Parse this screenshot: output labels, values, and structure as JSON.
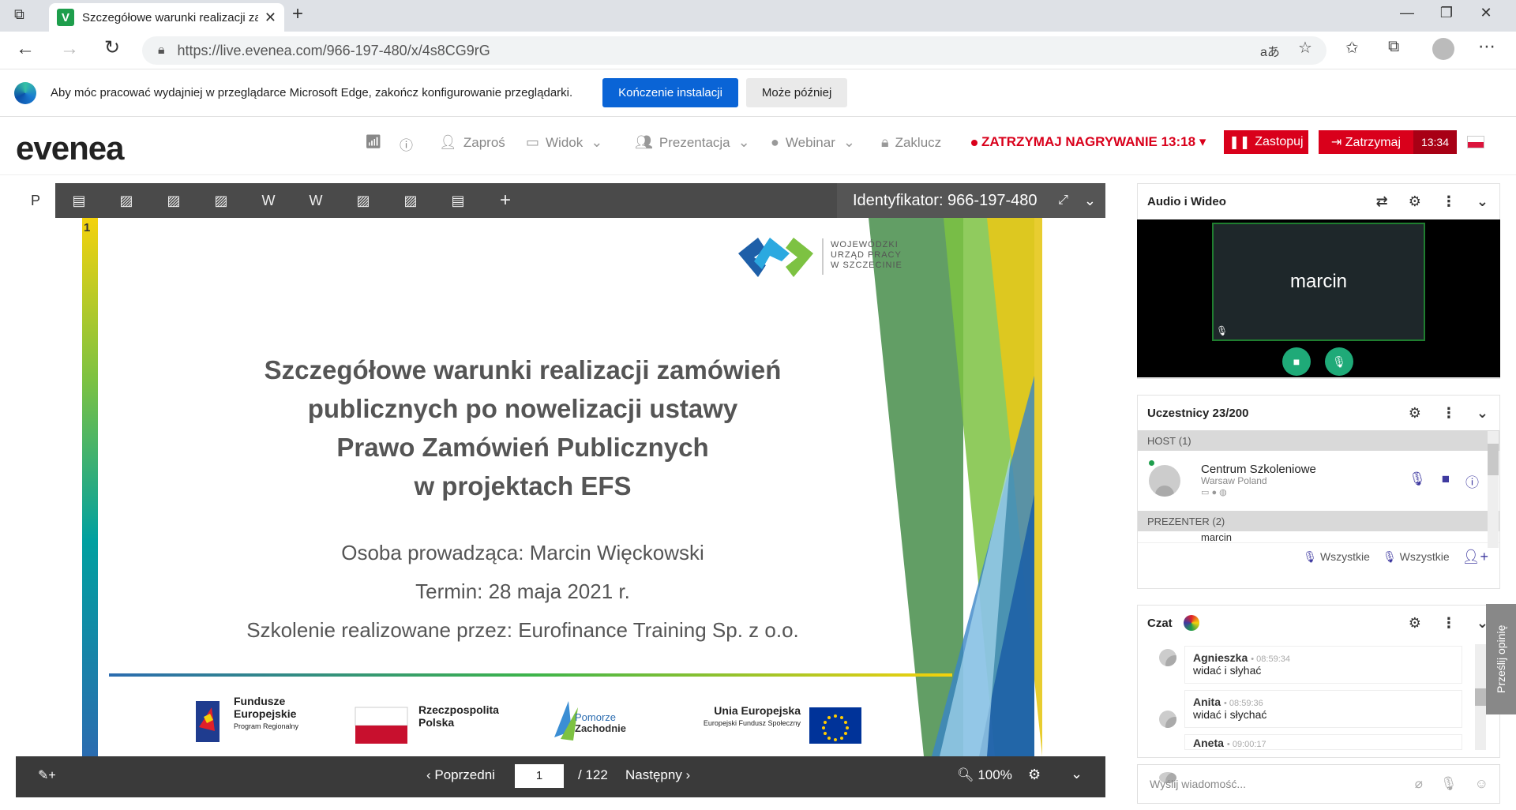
{
  "browser": {
    "tab_title": "Szczegółowe warunki realizacji za",
    "url": "https://live.evenea.com/966-197-480/x/4s8CG9rG"
  },
  "infobar": {
    "message": "Aby móc pracować wydajniej w przeglądarce Microsoft Edge, zakończ konfigurowanie przeglądarki.",
    "finish_label": "Kończenie instalacji",
    "later_label": "Może później"
  },
  "app": {
    "logo": "evenea",
    "menu": {
      "invite": "Zaproś",
      "view": "Widok",
      "presentation": "Prezentacja",
      "webinar": "Webinar",
      "lock": "Zaklucz"
    },
    "recording": "ZATRZYMAJ NAGRYWANIE 13:18",
    "replace_label": "Zastopuj",
    "stop_label": "Zatrzymaj",
    "stop_time": "13:34",
    "language_flag_colors": [
      "#ffffff",
      "#dc143c"
    ]
  },
  "presentation": {
    "identifier": "Identyfikator: 966-197-480",
    "slide_number": "1",
    "prev_label": "Poprzedni",
    "next_label": "Następny",
    "page_value": "1",
    "page_total": "/ 122",
    "zoom": "100%"
  },
  "slide": {
    "org_line1": "WOJEWÓDZKI",
    "org_line2": "URZĄD PRACY",
    "org_line3": "W SZCZECINIE",
    "title_line1": "Szczegółowe warunki realizacji zamówień",
    "title_line2": "publicznych po nowelizacji ustawy",
    "title_line3": "Prawo Zamówień Publicznych",
    "title_line4": "w projektach EFS",
    "presenter": "Osoba prowadząca: Marcin Więckowski",
    "date": "Termin: 28 maja 2021 r.",
    "provider": "Szkolenie realizowane przez: Eurofinance Training Sp. z o.o.",
    "logo_fe_1": "Fundusze",
    "logo_fe_2": "Europejskie",
    "logo_fe_3": "Program Regionalny",
    "logo_rp_1": "Rzeczpospolita",
    "logo_rp_2": "Polska",
    "logo_pz_1": "Pomorze",
    "logo_pz_2": "Zachodnie",
    "logo_ue_1": "Unia Europejska",
    "logo_ue_2": "Europejski Fundusz Społeczny"
  },
  "audio_video": {
    "title": "Audio i Wideo",
    "tile_name": "marcin"
  },
  "participants": {
    "title": "Uczestnicy 23/200",
    "host_group": "HOST",
    "host_count": "(1)",
    "host_name": "Centrum Szkoleniowe",
    "host_location": "Warsaw Poland",
    "presenter_group": "PREZENTER",
    "presenter_count": "(2)",
    "presenter_partial": "marcin",
    "mute_all": "Wszystkie",
    "unmute_all": "Wszystkie"
  },
  "chat": {
    "title": "Czat",
    "messages": [
      {
        "name": "Agnieszka",
        "time": "08:59:34",
        "text": "widać i  słyhać"
      },
      {
        "name": "Anita",
        "time": "08:59:36",
        "text": "widać i słychać"
      },
      {
        "name": "Aneta",
        "time": "09:00:17",
        "text": ""
      }
    ],
    "input_placeholder": "Wyślij wiadomość...",
    "feedback": "Prześlij opinię"
  }
}
